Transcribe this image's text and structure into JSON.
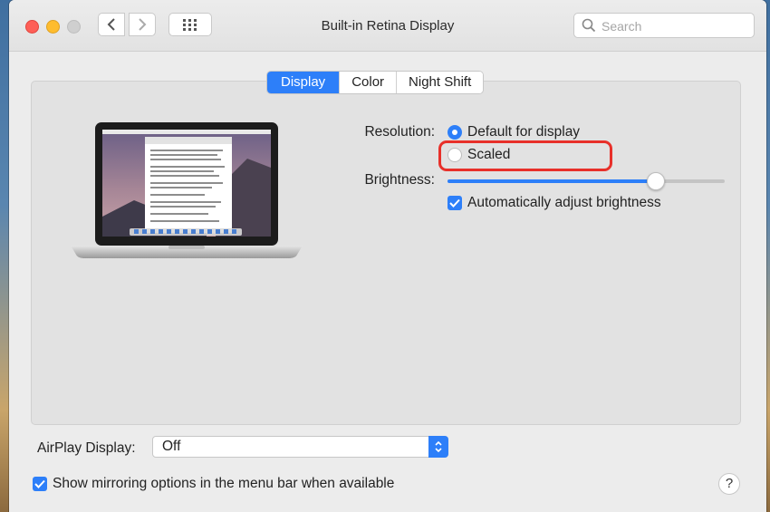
{
  "window": {
    "title": "Built-in Retina Display"
  },
  "search": {
    "placeholder": "Search"
  },
  "tabs": [
    {
      "label": "Display",
      "active": true
    },
    {
      "label": "Color",
      "active": false
    },
    {
      "label": "Night Shift",
      "active": false
    }
  ],
  "resolution": {
    "label": "Resolution:",
    "options": [
      {
        "label": "Default for display",
        "selected": true
      },
      {
        "label": "Scaled",
        "selected": false
      }
    ]
  },
  "brightness": {
    "label": "Brightness:",
    "level_fraction": 0.75,
    "auto_label": "Automatically adjust brightness",
    "auto_checked": true
  },
  "airplay": {
    "label": "AirPlay Display:",
    "value": "Off"
  },
  "mirroring": {
    "label": "Show mirroring options in the menu bar when available",
    "checked": true
  },
  "help": {
    "label": "?"
  },
  "colors": {
    "accent": "#2d7ff9",
    "highlight": "#e8302a"
  }
}
